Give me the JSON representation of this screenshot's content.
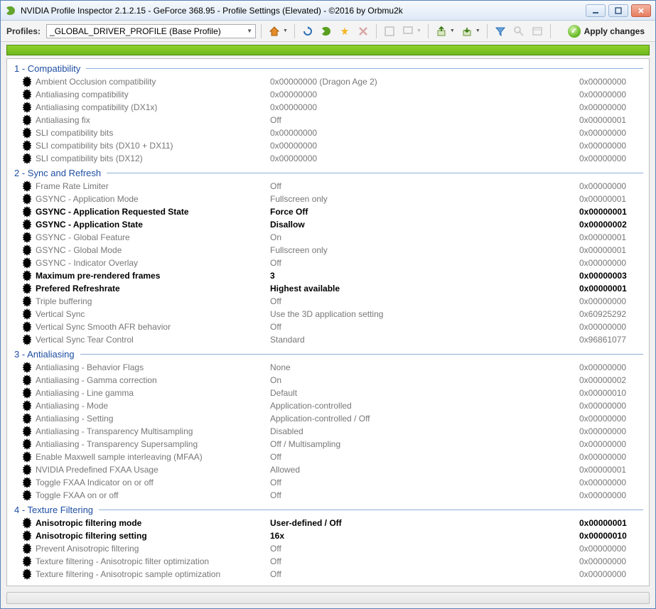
{
  "window": {
    "title": "NVIDIA Profile Inspector 2.1.2.15 - GeForce 368.95 - Profile Settings (Elevated) - ©2016 by Orbmu2k"
  },
  "toolbar": {
    "profiles_label": "Profiles:",
    "profile_selected": "_GLOBAL_DRIVER_PROFILE (Base Profile)",
    "apply_label": "Apply changes"
  },
  "sections": [
    {
      "title": "1 - Compatibility",
      "items": [
        {
          "name": "Ambient Occlusion compatibility",
          "value": "0x00000000 (Dragon Age 2)",
          "hex": "0x00000000",
          "modified": false
        },
        {
          "name": "Antialiasing compatibility",
          "value": "0x00000000",
          "hex": "0x00000000",
          "modified": false
        },
        {
          "name": "Antialiasing compatibility (DX1x)",
          "value": "0x00000000",
          "hex": "0x00000000",
          "modified": false
        },
        {
          "name": "Antialiasing fix",
          "value": "Off",
          "hex": "0x00000001",
          "modified": false
        },
        {
          "name": "SLI compatibility bits",
          "value": "0x00000000",
          "hex": "0x00000000",
          "modified": false
        },
        {
          "name": "SLI compatibility bits (DX10 + DX11)",
          "value": "0x00000000",
          "hex": "0x00000000",
          "modified": false
        },
        {
          "name": "SLI compatibility bits (DX12)",
          "value": "0x00000000",
          "hex": "0x00000000",
          "modified": false
        }
      ]
    },
    {
      "title": "2 - Sync and Refresh",
      "items": [
        {
          "name": "Frame Rate Limiter",
          "value": "Off",
          "hex": "0x00000000",
          "modified": false
        },
        {
          "name": "GSYNC - Application Mode",
          "value": "Fullscreen only",
          "hex": "0x00000001",
          "modified": false
        },
        {
          "name": "GSYNC - Application Requested State",
          "value": "Force Off",
          "hex": "0x00000001",
          "modified": true
        },
        {
          "name": "GSYNC - Application State",
          "value": "Disallow",
          "hex": "0x00000002",
          "modified": true
        },
        {
          "name": "GSYNC - Global Feature",
          "value": "On",
          "hex": "0x00000001",
          "modified": false
        },
        {
          "name": "GSYNC - Global Mode",
          "value": "Fullscreen only",
          "hex": "0x00000001",
          "modified": false
        },
        {
          "name": "GSYNC - Indicator Overlay",
          "value": "Off",
          "hex": "0x00000000",
          "modified": false
        },
        {
          "name": "Maximum pre-rendered frames",
          "value": "3",
          "hex": "0x00000003",
          "modified": true
        },
        {
          "name": "Prefered Refreshrate",
          "value": "Highest available",
          "hex": "0x00000001",
          "modified": true
        },
        {
          "name": "Triple buffering",
          "value": "Off",
          "hex": "0x00000000",
          "modified": false
        },
        {
          "name": "Vertical Sync",
          "value": "Use the 3D application setting",
          "hex": "0x60925292",
          "modified": false
        },
        {
          "name": "Vertical Sync Smooth AFR behavior",
          "value": "Off",
          "hex": "0x00000000",
          "modified": false
        },
        {
          "name": "Vertical Sync Tear Control",
          "value": "Standard",
          "hex": "0x96861077",
          "modified": false
        }
      ]
    },
    {
      "title": "3 - Antialiasing",
      "items": [
        {
          "name": "Antialiasing - Behavior Flags",
          "value": "None",
          "hex": "0x00000000",
          "modified": false
        },
        {
          "name": "Antialiasing - Gamma correction",
          "value": "On",
          "hex": "0x00000002",
          "modified": false
        },
        {
          "name": "Antialiasing - Line gamma",
          "value": "Default",
          "hex": "0x00000010",
          "modified": false
        },
        {
          "name": "Antialiasing - Mode",
          "value": "Application-controlled",
          "hex": "0x00000000",
          "modified": false
        },
        {
          "name": "Antialiasing - Setting",
          "value": "Application-controlled / Off",
          "hex": "0x00000000",
          "modified": false
        },
        {
          "name": "Antialiasing - Transparency Multisampling",
          "value": "Disabled",
          "hex": "0x00000000",
          "modified": false
        },
        {
          "name": "Antialiasing - Transparency Supersampling",
          "value": "Off / Multisampling",
          "hex": "0x00000000",
          "modified": false
        },
        {
          "name": "Enable Maxwell sample interleaving (MFAA)",
          "value": "Off",
          "hex": "0x00000000",
          "modified": false
        },
        {
          "name": "NVIDIA Predefined FXAA Usage",
          "value": "Allowed",
          "hex": "0x00000001",
          "modified": false
        },
        {
          "name": "Toggle FXAA Indicator on or off",
          "value": "Off",
          "hex": "0x00000000",
          "modified": false
        },
        {
          "name": "Toggle FXAA on or off",
          "value": "Off",
          "hex": "0x00000000",
          "modified": false
        }
      ]
    },
    {
      "title": "4 - Texture Filtering",
      "items": [
        {
          "name": "Anisotropic filtering mode",
          "value": "User-defined / Off",
          "hex": "0x00000001",
          "modified": true
        },
        {
          "name": "Anisotropic filtering setting",
          "value": "16x",
          "hex": "0x00000010",
          "modified": true
        },
        {
          "name": "Prevent Anisotropic filtering",
          "value": "Off",
          "hex": "0x00000000",
          "modified": false
        },
        {
          "name": "Texture filtering - Anisotropic filter optimization",
          "value": "Off",
          "hex": "0x00000000",
          "modified": false
        },
        {
          "name": "Texture filtering - Anisotropic sample optimization",
          "value": "Off",
          "hex": "0x00000000",
          "modified": false
        }
      ]
    }
  ]
}
